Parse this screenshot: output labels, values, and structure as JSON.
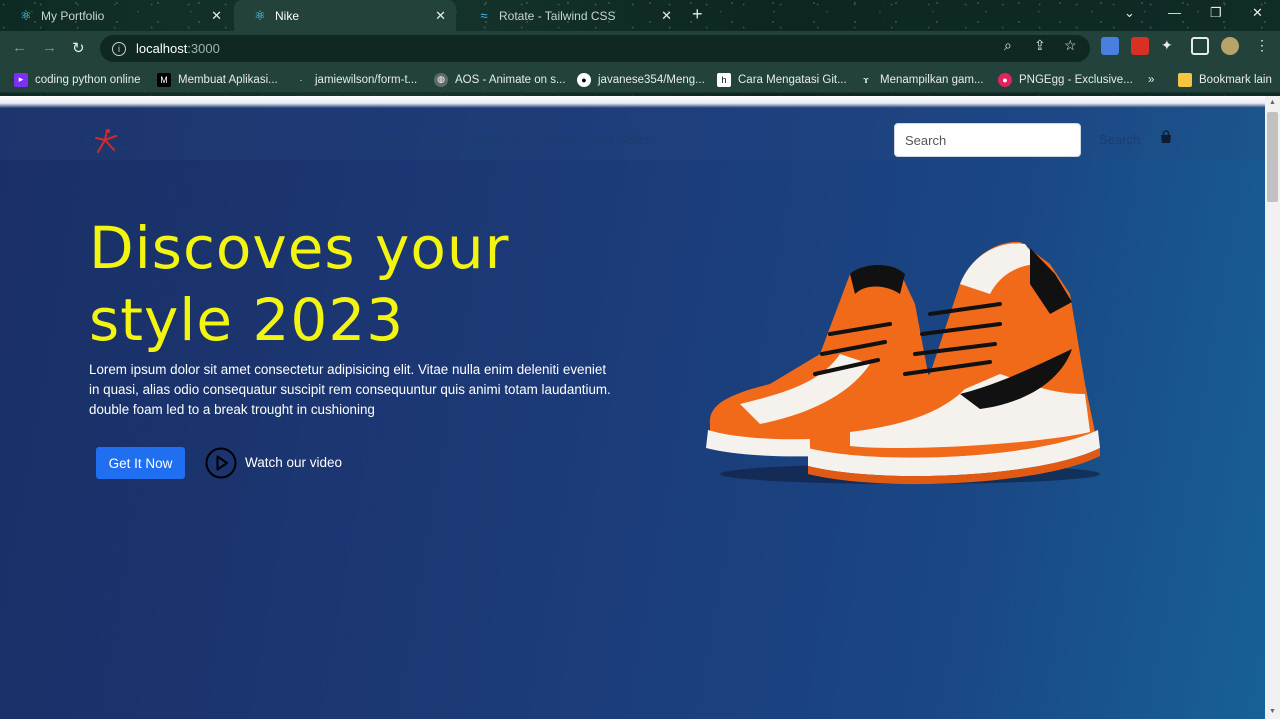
{
  "browser": {
    "tabs": [
      {
        "title": "My Portfolio",
        "icon": "react-icon",
        "active": false
      },
      {
        "title": "Nike",
        "icon": "react-icon",
        "active": true
      },
      {
        "title": "Rotate - Tailwind CSS",
        "icon": "tailwind-icon",
        "active": false
      }
    ],
    "url": {
      "host": "localhost",
      "port": ":3000"
    },
    "bookmarks": [
      {
        "label": "coding python online",
        "icon": "replit-icon",
        "color": "#f26207"
      },
      {
        "label": "Membuat Aplikasi...",
        "icon": "medium-icon",
        "color": "#000000"
      },
      {
        "label": "jamiewilson/form-t...",
        "icon": "page-icon",
        "color": "#22423b"
      },
      {
        "label": "AOS - Animate on s...",
        "icon": "globe-icon",
        "color": "#5f6b69"
      },
      {
        "label": "javanese354/Meng...",
        "icon": "github-icon",
        "color": "#000000"
      },
      {
        "label": "Cara Mengatasi Git...",
        "icon": "hashnode-icon",
        "color": "#000000"
      },
      {
        "label": "Menampilkan gam...",
        "icon": "bookmark-x-icon",
        "color": "#22423b"
      },
      {
        "label": "PNGEgg - Exclusive...",
        "icon": "pngegg-icon",
        "color": "#e0245e"
      }
    ],
    "bookmarks_more": "»",
    "bookmarks_folder": "Bookmark lain"
  },
  "site": {
    "nav": {
      "items": [
        "Tranding",
        "Men",
        "About Us",
        "Future",
        "Best Seller"
      ],
      "search_placeholder": "Search",
      "search_label": "Search"
    },
    "hero": {
      "title_line1": "Discoves your",
      "title_line2": "style 2023",
      "description": "Lorem ipsum dolor sit amet consectetur adipisicing elit. Vitae nulla enim deleniti eveniet in quasi, alias odio consequatur suscipit rem consequuntur quis animi totam laudantium. double foam led to a break trought in cushioning",
      "cta_label": "Get It Now",
      "video_label": "Watch our video"
    }
  },
  "colors": {
    "title": "#f3f511",
    "cta": "#1f6ff0",
    "shoe_orange": "#f06a1a"
  }
}
